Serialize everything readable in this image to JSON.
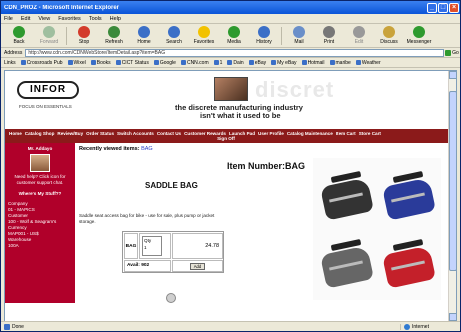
{
  "window": {
    "title": "CDN_PROZ - Microsoft Internet Explorer"
  },
  "menu": [
    "File",
    "Edit",
    "View",
    "Favorites",
    "Tools",
    "Help"
  ],
  "toolbar": [
    {
      "label": "Back",
      "icon": "back-arrow-icon",
      "color": "#2e9a2e"
    },
    {
      "label": "Forward",
      "icon": "forward-arrow-icon",
      "color": "#9fbf9f"
    },
    {
      "label": "Stop",
      "icon": "stop-icon",
      "color": "#d33b2b"
    },
    {
      "label": "Refresh",
      "icon": "refresh-icon",
      "color": "#3b8a3b"
    },
    {
      "label": "Home",
      "icon": "home-icon",
      "color": "#3b6fc7"
    },
    {
      "label": "Search",
      "icon": "search-icon",
      "color": "#3b6fc7"
    },
    {
      "label": "Favorites",
      "icon": "star-icon",
      "color": "#f2c200"
    },
    {
      "label": "Media",
      "icon": "media-icon",
      "color": "#2e9a2e"
    },
    {
      "label": "History",
      "icon": "history-icon",
      "color": "#3b6fc7"
    },
    {
      "label": "Mail",
      "icon": "mail-icon",
      "color": "#6a8fc9"
    },
    {
      "label": "Print",
      "icon": "print-icon",
      "color": "#777777"
    },
    {
      "label": "Edit",
      "icon": "edit-icon",
      "color": "#999999"
    },
    {
      "label": "Discuss",
      "icon": "discuss-icon",
      "color": "#c9a33b"
    },
    {
      "label": "Messenger",
      "icon": "messenger-icon",
      "color": "#2e9a2e"
    }
  ],
  "address": {
    "label": "Address",
    "url": "http://www.cdn.com/CDNWebStore/ItemDetail.asp?item=BAG",
    "go_label": "Go"
  },
  "links": {
    "label": "Links",
    "items": [
      "Crossroads Pub",
      "Wixel",
      "Books",
      "CICT Status",
      "Google",
      "CNN.com",
      "1",
      "Dain",
      "eBay",
      "My eBay",
      "Hotmail",
      "maribe",
      "Weather"
    ]
  },
  "site": {
    "logo": "INFOR",
    "logo_tagline": "FOCUS ON ESSENTIALS",
    "tagline1": "the discrete manufacturing industry",
    "tagline2": "isn't what it used to be",
    "watermark": "discret",
    "nav": [
      "Home",
      "Catalog Shop",
      "Review/Buy",
      "Order Status",
      "Switch Accounts",
      "Contact Us",
      "Customer Rewards",
      "Launch Pad",
      "User Profile",
      "Catalog Maintenance",
      "Item Cart",
      "Store Cart"
    ],
    "sign_off": "Sign Off"
  },
  "sidebar": {
    "user": "Mr. Addayo",
    "help": "Need help? Click icon for customer support chat.",
    "whats_my_stuff": "Where's My Stuff??",
    "company_label": "Company",
    "company": "01 - MAPICS",
    "customer_label": "Customer",
    "customer": "100 - Wolf & Seagram's",
    "currency_label": "Currency",
    "currency": "MAP001 - US$",
    "warehouse_label": "Warehouse",
    "warehouse": "100A"
  },
  "main": {
    "recent_label": "Recently viewed items:",
    "recent_item": "BAG",
    "item_number": "Item Number:BAG",
    "product_name": "SADDLE BAG",
    "description": "Saddle seat access bag for bike - use for sale, plus pump or jacket storage.",
    "order": {
      "um": "BAG",
      "qty_label": "Qty",
      "qty_value": "1",
      "price": "24.78",
      "avail": "Avail: 902",
      "add_label": "Add"
    }
  },
  "status": {
    "text": "Done",
    "zone": "Internet"
  },
  "bag_colors": [
    "#333333",
    "#2a3b9a",
    "#666666",
    "#c4202a"
  ]
}
